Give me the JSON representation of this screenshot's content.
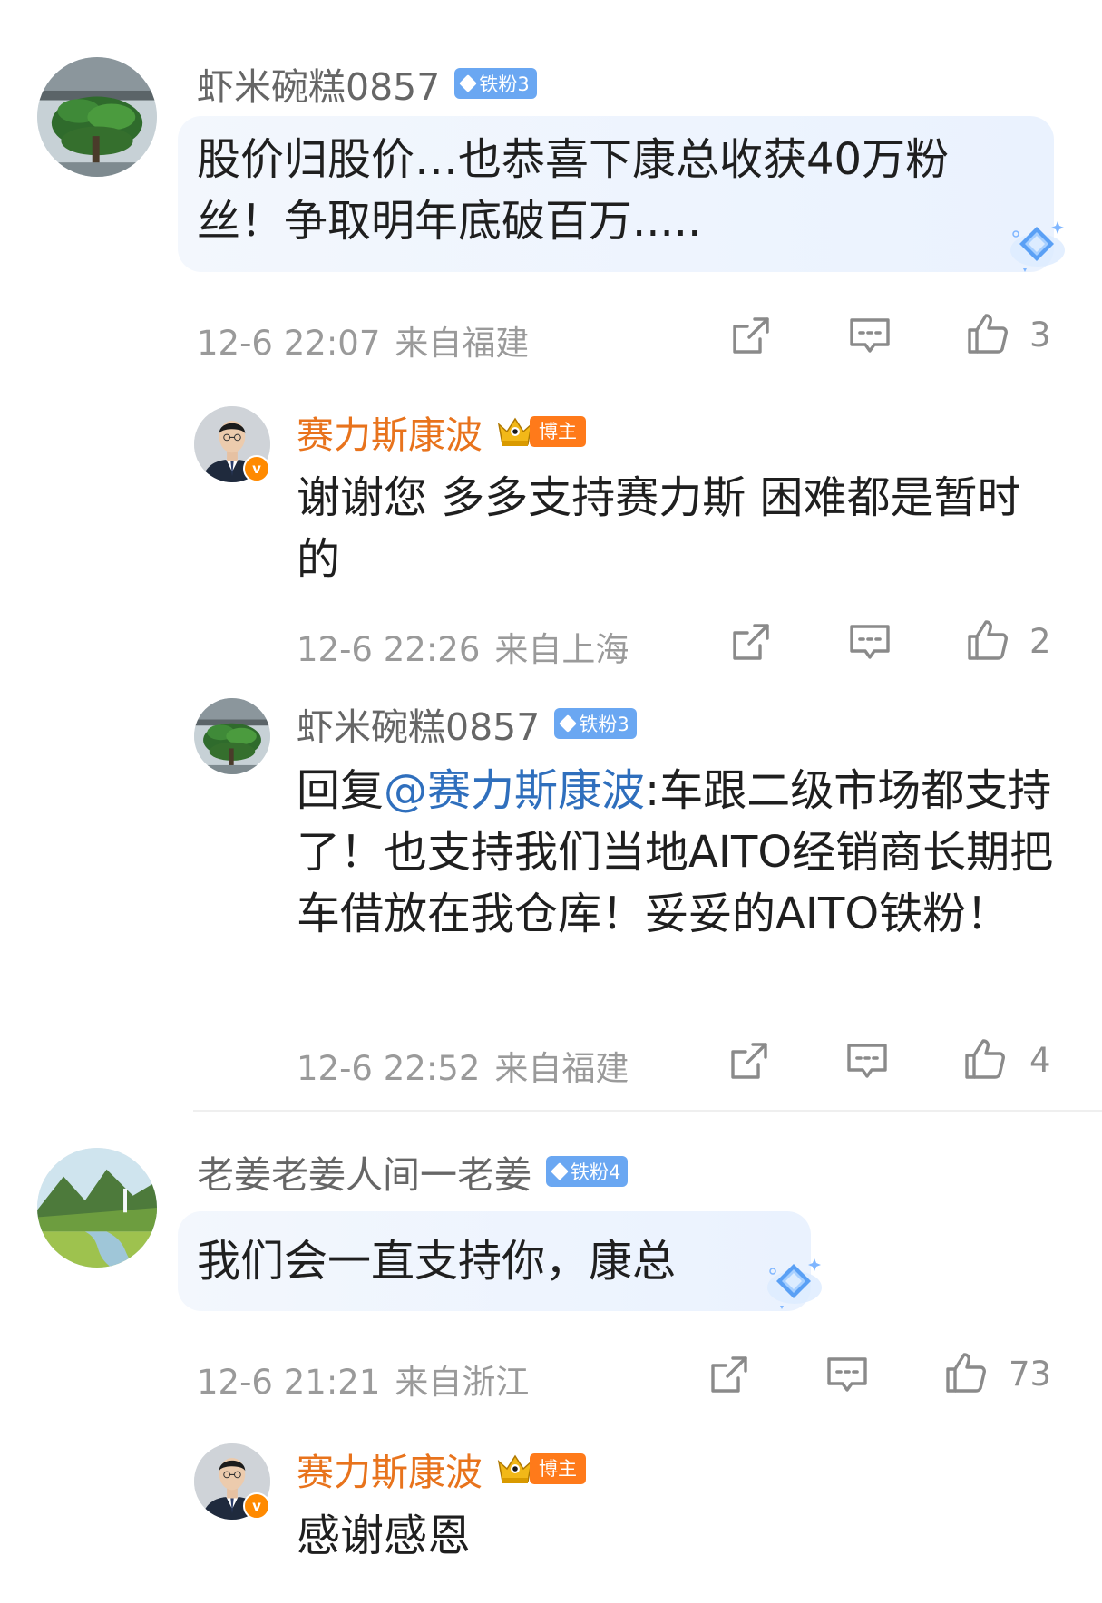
{
  "comments": [
    {
      "username": "虾米碗糕0857",
      "badge": "铁粉3",
      "text": "股价归股价…也恭喜下康总收获40万粉丝！争取明年底破百万.....",
      "time": "12-6 22:07",
      "location": "来自福建",
      "likes": "3",
      "replies": [
        {
          "username": "赛力斯康波",
          "badge": "博主",
          "text": "谢谢您 多多支持赛力斯 困难都是暂时的",
          "time": "12-6 22:26",
          "location": "来自上海",
          "likes": "2"
        },
        {
          "username": "虾米碗糕0857",
          "badge": "铁粉3",
          "reply_prefix": "回复",
          "mention": "@赛力斯康波",
          "text": ":车跟二级市场都支持了！也支持我们当地AITO经销商长期把车借放在我仓库！妥妥的AITO铁粉！",
          "time": "12-6 22:52",
          "location": "来自福建",
          "likes": "4"
        }
      ]
    },
    {
      "username": "老姜老姜人间一老姜",
      "badge": "铁粉4",
      "text": "我们会一直支持你，康总",
      "time": "12-6 21:21",
      "location": "来自浙江",
      "likes": "73",
      "replies": [
        {
          "username": "赛力斯康波",
          "badge": "博主",
          "text": "感谢感恩"
        }
      ]
    }
  ],
  "colors": {
    "author_name": "#e8731c",
    "mention": "#2f6fbd",
    "fan_badge": "#6aa7f2",
    "blogger_badge": "#ff7a1a"
  },
  "icons": [
    "share-icon",
    "comment-icon",
    "like-icon",
    "diamond-icon",
    "crown-icon",
    "verified-icon"
  ]
}
